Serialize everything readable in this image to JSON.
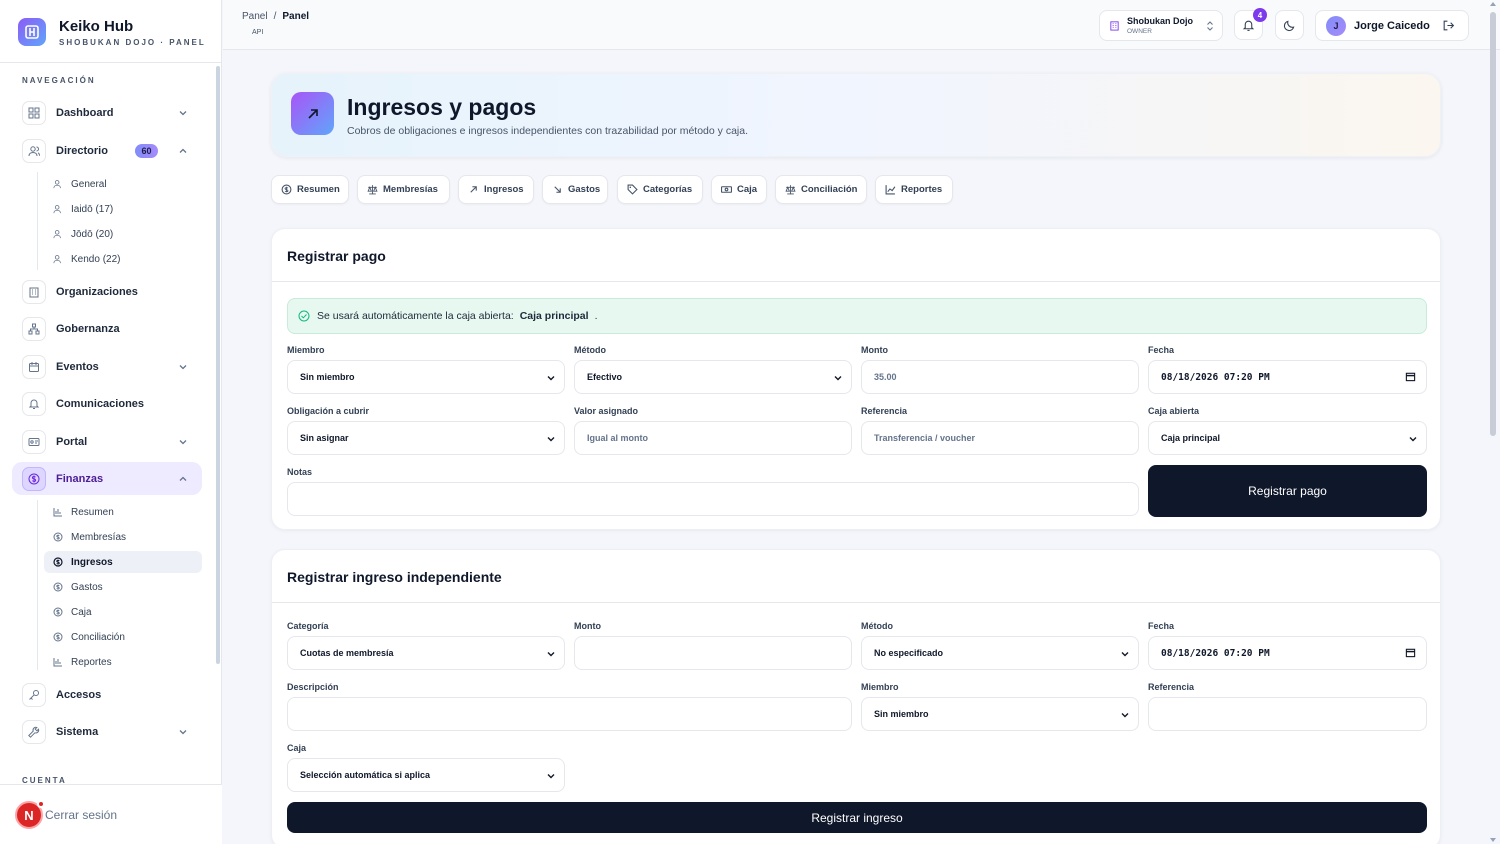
{
  "brand": {
    "title": "Keiko Hub",
    "subtitle": "SHOBUKAN DOJO · PANEL"
  },
  "sidebar": {
    "nav_label": "NAVEGACIÓN",
    "account_label": "CUENTA",
    "items": [
      {
        "label": "Dashboard",
        "icon": "grid-icon"
      },
      {
        "label": "Directorio",
        "badge": "60",
        "icon": "users-icon"
      },
      {
        "label": "Organizaciones",
        "icon": "building-icon"
      },
      {
        "label": "Gobernanza",
        "icon": "hierarchy-icon"
      },
      {
        "label": "Eventos",
        "icon": "calendar-icon"
      },
      {
        "label": "Comunicaciones",
        "icon": "bell-icon"
      },
      {
        "label": "Portal",
        "icon": "id-card-icon"
      },
      {
        "label": "Finanzas",
        "icon": "dollar-icon"
      },
      {
        "label": "Accesos",
        "icon": "key-icon"
      },
      {
        "label": "Sistema",
        "icon": "wrench-icon"
      }
    ],
    "directorio_sub": [
      "General",
      "Iaidō (17)",
      "Jōdō (20)",
      "Kendo (22)"
    ],
    "finanzas_sub": [
      "Resumen",
      "Membresías",
      "Ingresos",
      "Gastos",
      "Caja",
      "Conciliación",
      "Reportes"
    ],
    "avatar_letter": "N",
    "logout_label": "Cerrar sesión"
  },
  "header": {
    "breadcrumb": [
      "Panel",
      "/",
      "Panel"
    ],
    "api_tag": "API",
    "org_name": "Shobukan Dojo",
    "org_role": "OWNER",
    "notifications": "4",
    "user_initial": "J",
    "user_name": "Jorge Caicedo"
  },
  "hero": {
    "title": "Ingresos y pagos",
    "subtitle": "Cobros de obligaciones e ingresos independientes con trazabilidad por método y caja."
  },
  "tabs": [
    "Resumen",
    "Membresías",
    "Ingresos",
    "Gastos",
    "Categorías",
    "Caja",
    "Conciliación",
    "Reportes"
  ],
  "payment_form": {
    "title": "Registrar pago",
    "notice_text": "Se usará automáticamente la caja abierta:",
    "notice_value": "Caja principal",
    "notice_end": ".",
    "member_label": "Miembro",
    "member_value": "Sin miembro",
    "method_label": "Método",
    "method_value": "Efectivo",
    "amount_label": "Monto",
    "amount_placeholder": "35.00",
    "date_label": "Fecha",
    "date_value": "08/18/2026 07:20 PM",
    "obligation_label": "Obligación a cubrir",
    "obligation_value": "Sin asignar",
    "assigned_label": "Valor asignado",
    "assigned_placeholder": "Igual al monto",
    "reference_label": "Referencia",
    "reference_placeholder": "Transferencia / voucher",
    "cash_label": "Caja abierta",
    "cash_value": "Caja principal",
    "notes_label": "Notas",
    "submit": "Registrar pago"
  },
  "income_form": {
    "title": "Registrar ingreso independiente",
    "category_label": "Categoría",
    "category_value": "Cuotas de membresía",
    "amount_label": "Monto",
    "method_label": "Método",
    "method_value": "No especificado",
    "date_label": "Fecha",
    "date_value": "08/18/2026 07:20 PM",
    "description_label": "Descripción",
    "member_label": "Miembro",
    "member_value": "Sin miembro",
    "reference_label": "Referencia",
    "cash_label": "Caja",
    "cash_value": "Selección automática si aplica",
    "submit": "Registrar ingreso"
  }
}
